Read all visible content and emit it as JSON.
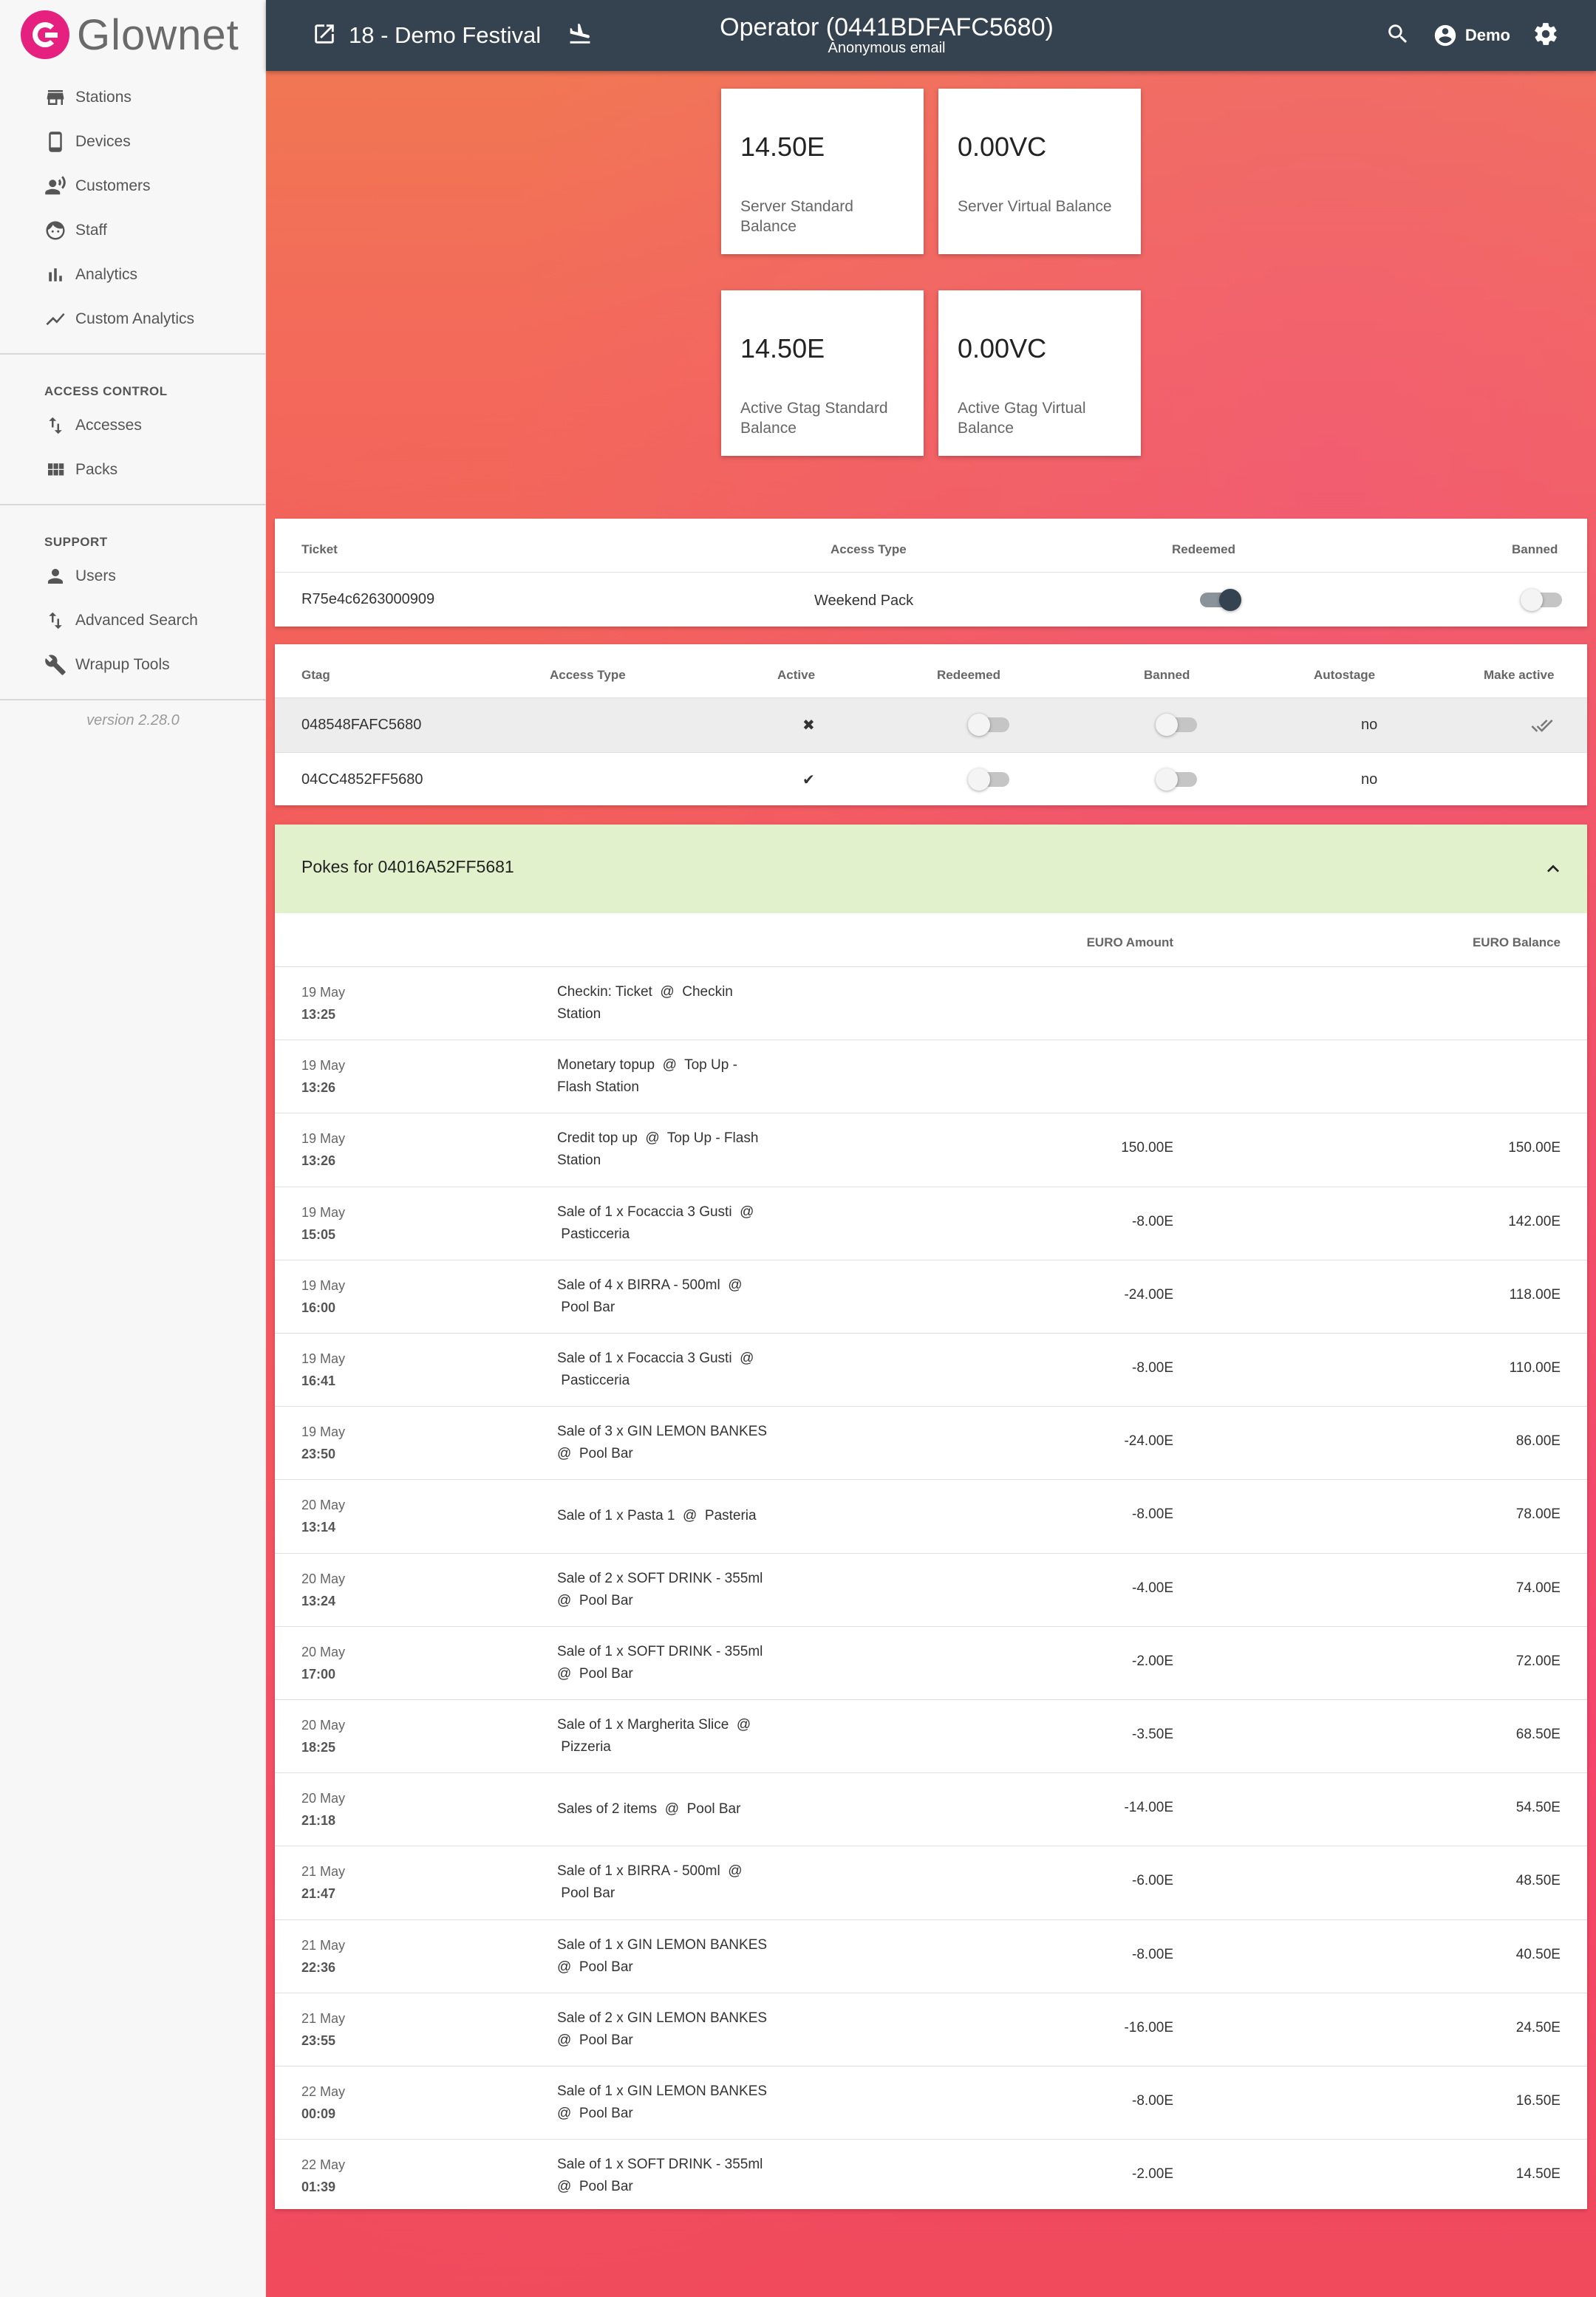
{
  "app": {
    "logo_text": "Glownet",
    "version": "version 2.28.0"
  },
  "sidebar": {
    "main_items": [
      {
        "label": "Stations",
        "icon": "store-icon"
      },
      {
        "label": "Devices",
        "icon": "phone-icon"
      },
      {
        "label": "Customers",
        "icon": "customer-voice-icon"
      },
      {
        "label": "Staff",
        "icon": "face-icon"
      },
      {
        "label": "Analytics",
        "icon": "bar-chart-icon"
      },
      {
        "label": "Custom Analytics",
        "icon": "trending-line-icon"
      }
    ],
    "access_control_label": "ACCESS CONTROL",
    "access_items": [
      {
        "label": "Accesses",
        "icon": "import-export-icon"
      },
      {
        "label": "Packs",
        "icon": "grid-icon"
      }
    ],
    "support_label": "SUPPORT",
    "support_items": [
      {
        "label": "Users",
        "icon": "person-icon"
      },
      {
        "label": "Advanced Search",
        "icon": "import-export-icon"
      },
      {
        "label": "Wrapup Tools",
        "icon": "wrench-icon"
      }
    ]
  },
  "header": {
    "event_title": "18 - Demo Festival",
    "operator_title": "Operator (0441BDFAFC5680)",
    "operator_subtitle": "Anonymous email",
    "user_name": "Demo"
  },
  "balances": [
    {
      "value": "14.50E",
      "label": "Server Standard Balance"
    },
    {
      "value": "0.00VC",
      "label": "Server Virtual Balance"
    },
    {
      "value": "14.50E",
      "label": "Active Gtag Standard Balance"
    },
    {
      "value": "0.00VC",
      "label": "Active Gtag Virtual Balance"
    }
  ],
  "tickets": {
    "headers": {
      "ticket": "Ticket",
      "access_type": "Access Type",
      "redeemed": "Redeemed",
      "banned": "Banned"
    },
    "rows": [
      {
        "ticket": "R75e4c6263000909",
        "access_type": "Weekend Pack",
        "redeemed": true,
        "banned": false
      }
    ]
  },
  "gtags": {
    "headers": {
      "gtag": "Gtag",
      "access_type": "Access Type",
      "active": "Active",
      "redeemed": "Redeemed",
      "banned": "Banned",
      "autostage": "Autostage",
      "make_active": "Make active"
    },
    "rows": [
      {
        "gtag": "048548FAFC5680",
        "active_mark": "✖",
        "redeemed": false,
        "banned": false,
        "autostage": "no",
        "make_active": true
      },
      {
        "gtag": "04CC4852FF5680",
        "active_mark": "✔",
        "redeemed": false,
        "banned": false,
        "autostage": "no",
        "make_active": false
      }
    ]
  },
  "pokes": {
    "title": "Pokes for 04016A52FF5681",
    "headers": {
      "amount": "EURO Amount",
      "balance": "EURO Balance"
    },
    "rows": [
      {
        "date": "19 May",
        "time": "13:25",
        "desc1": "Checkin: Ticket  @  Checkin",
        "desc2": "Station",
        "amount": "",
        "balance": ""
      },
      {
        "date": "19 May",
        "time": "13:26",
        "desc1": "Monetary topup  @  Top Up -",
        "desc2": "Flash Station",
        "amount": "",
        "balance": ""
      },
      {
        "date": "19 May",
        "time": "13:26",
        "desc1": "Credit top up  @  Top Up - Flash",
        "desc2": "Station",
        "amount": "150.00E",
        "balance": "150.00E"
      },
      {
        "date": "19 May",
        "time": "15:05",
        "desc1": "Sale of 1 x Focaccia 3 Gusti  @",
        "desc2": " Pasticceria",
        "amount": "-8.00E",
        "balance": "142.00E"
      },
      {
        "date": "19 May",
        "time": "16:00",
        "desc1": "Sale of 4 x BIRRA - 500ml  @",
        "desc2": " Pool Bar",
        "amount": "-24.00E",
        "balance": "118.00E"
      },
      {
        "date": "19 May",
        "time": "16:41",
        "desc1": "Sale of 1 x Focaccia 3 Gusti  @",
        "desc2": " Pasticceria",
        "amount": "-8.00E",
        "balance": "110.00E"
      },
      {
        "date": "19 May",
        "time": "23:50",
        "desc1": "Sale of 3 x GIN LEMON BANKES",
        "desc2": "@  Pool Bar",
        "amount": "-24.00E",
        "balance": "86.00E"
      },
      {
        "date": "20 May",
        "time": "13:14",
        "desc1": "Sale of 1 x Pasta 1  @  Pasteria",
        "desc2": "",
        "amount": "-8.00E",
        "balance": "78.00E"
      },
      {
        "date": "20 May",
        "time": "13:24",
        "desc1": "Sale of 2 x SOFT DRINK - 355ml",
        "desc2": "@  Pool Bar",
        "amount": "-4.00E",
        "balance": "74.00E"
      },
      {
        "date": "20 May",
        "time": "17:00",
        "desc1": "Sale of 1 x SOFT DRINK - 355ml",
        "desc2": "@  Pool Bar",
        "amount": "-2.00E",
        "balance": "72.00E"
      },
      {
        "date": "20 May",
        "time": "18:25",
        "desc1": "Sale of 1 x Margherita Slice  @",
        "desc2": " Pizzeria",
        "amount": "-3.50E",
        "balance": "68.50E"
      },
      {
        "date": "20 May",
        "time": "21:18",
        "desc1": "Sales of 2 items  @  Pool Bar",
        "desc2": "",
        "amount": "-14.00E",
        "balance": "54.50E"
      },
      {
        "date": "21 May",
        "time": "21:47",
        "desc1": "Sale of 1 x BIRRA - 500ml  @",
        "desc2": " Pool Bar",
        "amount": "-6.00E",
        "balance": "48.50E"
      },
      {
        "date": "21 May",
        "time": "22:36",
        "desc1": "Sale of 1 x GIN LEMON BANKES",
        "desc2": "@  Pool Bar",
        "amount": "-8.00E",
        "balance": "40.50E"
      },
      {
        "date": "21 May",
        "time": "23:55",
        "desc1": "Sale of 2 x GIN LEMON BANKES",
        "desc2": "@  Pool Bar",
        "amount": "-16.00E",
        "balance": "24.50E"
      },
      {
        "date": "22 May",
        "time": "00:09",
        "desc1": "Sale of 1 x GIN LEMON BANKES",
        "desc2": "@  Pool Bar",
        "amount": "-8.00E",
        "balance": "16.50E"
      },
      {
        "date": "22 May",
        "time": "01:39",
        "desc1": "Sale of 1 x SOFT DRINK - 355ml",
        "desc2": "@  Pool Bar",
        "amount": "-2.00E",
        "balance": "14.50E"
      }
    ]
  },
  "colors": {
    "header_bg": "#34434f",
    "accent": "#e5207e",
    "pokes_header_bg": "#e0f1cc"
  }
}
